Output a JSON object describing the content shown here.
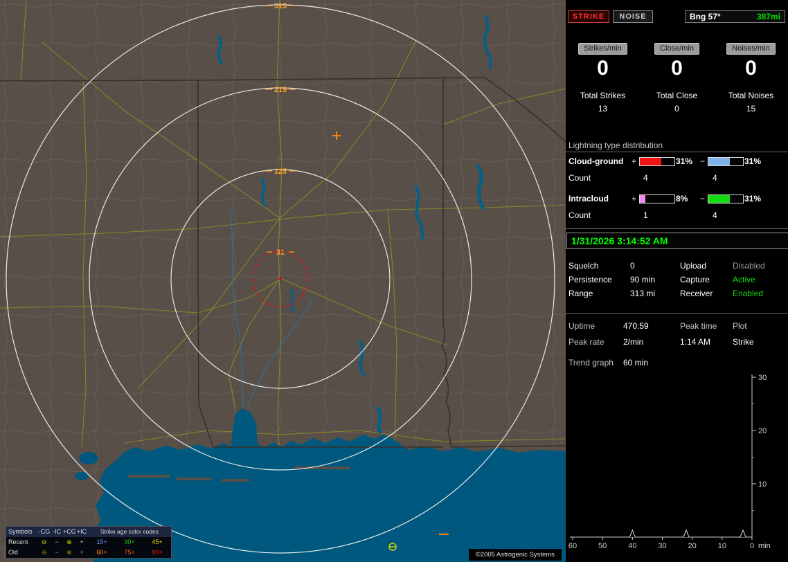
{
  "map": {
    "ring_labels": [
      "313",
      "219",
      "125",
      "31"
    ],
    "copyright": "©2005 Astrogenic Systems",
    "legend": {
      "symbols_header": "Symbols",
      "columns": [
        "-CG",
        "-IC",
        "+CG",
        "+IC"
      ],
      "age_header": "Strike age color codes",
      "rows": [
        {
          "label": "Recent",
          "symbols": [
            {
              "glyph": "⊖",
              "color": "#d8d800"
            },
            {
              "glyph": "−",
              "color": "#cfcfcf"
            },
            {
              "glyph": "⊕",
              "color": "#d8d800"
            },
            {
              "glyph": "+",
              "color": "#cfcfcf"
            }
          ],
          "ages": [
            {
              "text": "15+",
              "color": "#6b8cff"
            },
            {
              "text": "30+",
              "color": "#19c819"
            },
            {
              "text": "45+",
              "color": "#d8d800"
            }
          ]
        },
        {
          "label": "Old",
          "symbols": [
            {
              "glyph": "⊖",
              "color": "#a89000"
            },
            {
              "glyph": "−",
              "color": "#9a9a9a"
            },
            {
              "glyph": "⊕",
              "color": "#a89000"
            },
            {
              "glyph": "+",
              "color": "#9a9a9a"
            }
          ],
          "ages": [
            {
              "text": "60+",
              "color": "#ff9000"
            },
            {
              "text": "75+",
              "color": "#ff5a00"
            },
            {
              "text": "90+",
              "color": "#ff1414"
            }
          ]
        }
      ]
    }
  },
  "sidebar": {
    "strike_button": "STRIKE",
    "noise_button": "NOISE",
    "bearing": {
      "label": "Bng 57°",
      "distance": "387mi"
    },
    "columns": [
      {
        "rate_button": "Strikes/min",
        "rate": "0",
        "total_label": "Total Strikes",
        "total": "13"
      },
      {
        "rate_button": "Close/min",
        "rate": "0",
        "total_label": "Total Close",
        "total": "0"
      },
      {
        "rate_button": "Noises/min",
        "rate": "0",
        "total_label": "Total Noises",
        "total": "15"
      }
    ],
    "distribution": {
      "header": "Lightning type distribution",
      "cloud_ground": {
        "label": "Cloud-ground",
        "plus_sign": "+",
        "plus_pct": "31%",
        "plus_color": "#f01414",
        "plus_fill": 62,
        "minus_sign": "−",
        "minus_pct": "31%",
        "minus_color": "#7fb4e8",
        "minus_fill": 62,
        "count_label": "Count",
        "plus_count": "4",
        "minus_count": "4"
      },
      "intracloud": {
        "label": "Intracloud",
        "plus_sign": "+",
        "plus_pct": "8%",
        "plus_color": "#f08ae6",
        "plus_fill": 16,
        "minus_sign": "−",
        "minus_pct": "31%",
        "minus_color": "#14dc14",
        "minus_fill": 62,
        "count_label": "Count",
        "plus_count": "1",
        "minus_count": "4"
      }
    },
    "datetime": "1/31/2026 3:14:52 AM",
    "settings": {
      "rows": [
        {
          "l1": "Squelch",
          "v1": "0",
          "l2": "Upload",
          "v2": "Disabled",
          "v2_color": "#9a9a9a"
        },
        {
          "l1": "Persistence",
          "v1": "90 min",
          "l2": "Capture",
          "v2": "Active",
          "v2_color": "#14dc14"
        },
        {
          "l1": "Range",
          "v1": "313 mi",
          "l2": "Receiver",
          "v2": "Enabled",
          "v2_color": "#14dc14"
        }
      ]
    },
    "status": {
      "uptime_label": "Uptime",
      "uptime": "470:59",
      "peak_time_label": "Peak time",
      "peak_time": "1:14 AM",
      "plot_label": "Plot",
      "plot": "Strike",
      "peak_rate_label": "Peak rate",
      "peak_rate": "2/min",
      "trend_label": "Trend graph",
      "trend_window": "60 min"
    }
  },
  "trend": {
    "y_ticks": [
      30,
      20,
      10
    ],
    "x_ticks": [
      60,
      50,
      40,
      30,
      20,
      10,
      0
    ],
    "x_unit": "min",
    "spikes": [
      {
        "minute": 40
      },
      {
        "minute": 22
      },
      {
        "minute": 3
      }
    ]
  }
}
